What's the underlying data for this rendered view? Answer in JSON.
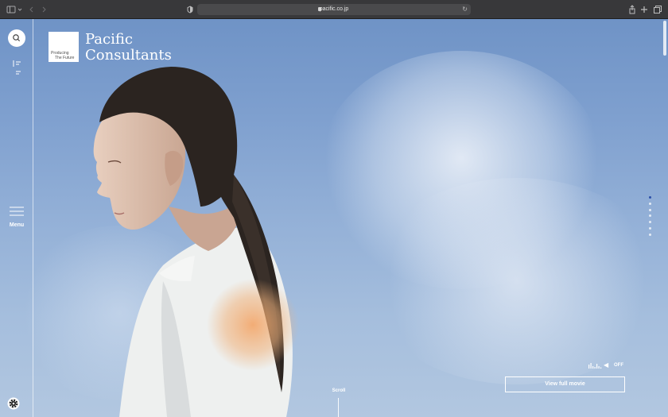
{
  "browser": {
    "url": "pacific.co.jp",
    "icons": [
      "sidebar-icon",
      "chevron-down-icon",
      "back-icon",
      "forward-icon",
      "shield-icon",
      "lock-icon",
      "reload-icon",
      "share-icon",
      "new-tab-icon",
      "tabs-icon"
    ]
  },
  "site": {
    "logo": {
      "tagline_line1": "Producing",
      "tagline_line2": "The Future",
      "name_line1": "Pacific",
      "name_line2": "Consultants"
    },
    "sidebar": {
      "menu_label": "Menu",
      "icons": [
        "search-icon",
        "list-icon",
        "hamburger-icon",
        "gear-icon"
      ]
    },
    "hero": {
      "slide_count": 7,
      "active_slide": 1,
      "sound_status": "OFF",
      "view_movie_label": "View full movie",
      "scroll_label": "Scroll"
    },
    "colors": {
      "accent": "#2c4fa8",
      "sky": "#7fa0cf"
    }
  }
}
